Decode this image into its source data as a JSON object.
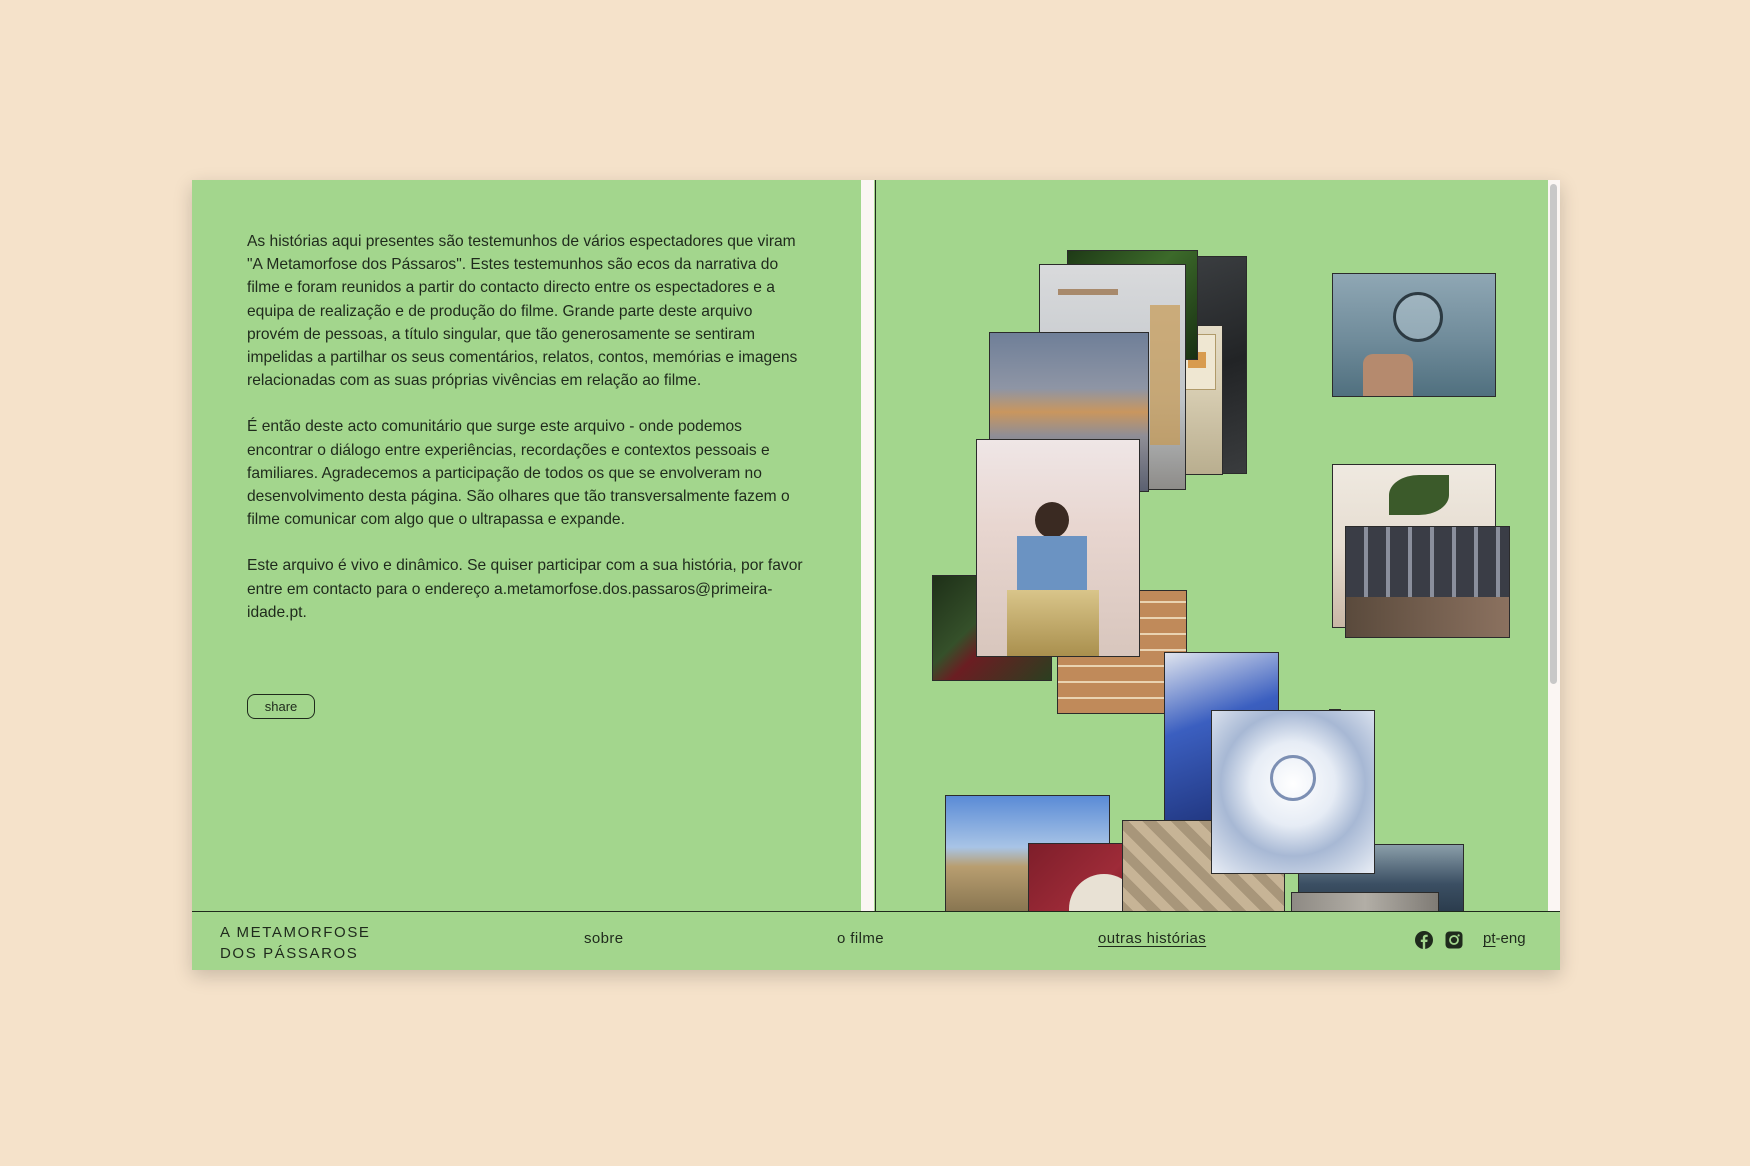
{
  "intro": {
    "paragraphs": [
      "As histórias aqui presentes são testemunhos de vários espectadores que viram \"A Metamorfose dos Pássaros\". Estes testemunhos são ecos da narrativa do filme e foram reunidos a partir do contacto directo entre os espectadores e a equipa de realização e de produção do filme. Grande parte deste arquivo provém de pessoas, a título singular, que tão generosamente se sentiram impelidas a partilhar os seus comentários, relatos, contos, memórias e imagens relacionadas com as suas próprias vivências em relação ao filme.",
      "É então deste acto comunitário que surge este arquivo - onde podemos encontrar o diálogo entre experiências, recordações e contextos pessoais e familiares. Agradecemos a participação de todos os que se envolveram no desenvolvimento desta página. São olhares que tão transversalmente fazem o filme comunicar com algo que o ultrapassa e expande.",
      "Este arquivo é vivo e dinâmico. Se quiser participar com a sua história, por favor entre em contacto para o endereço a.metamorfose.dos.passaros@primeira-idade.pt."
    ],
    "share_label": "share"
  },
  "footer": {
    "logo_line1": "A METAMORFOSE",
    "logo_line2": "DOS PÁSSAROS",
    "nav": {
      "sobre": "sobre",
      "o_filme": "o filme",
      "outras_historias": "outras histórias"
    },
    "lang_current": "pt",
    "lang_sep": "-",
    "lang_other": "eng"
  },
  "icons": {
    "facebook": "facebook-icon",
    "instagram": "instagram-icon"
  },
  "colors": {
    "page_background": "#f5e2ca",
    "panel_green": "#a3d68d",
    "text": "#1f2a1c"
  }
}
